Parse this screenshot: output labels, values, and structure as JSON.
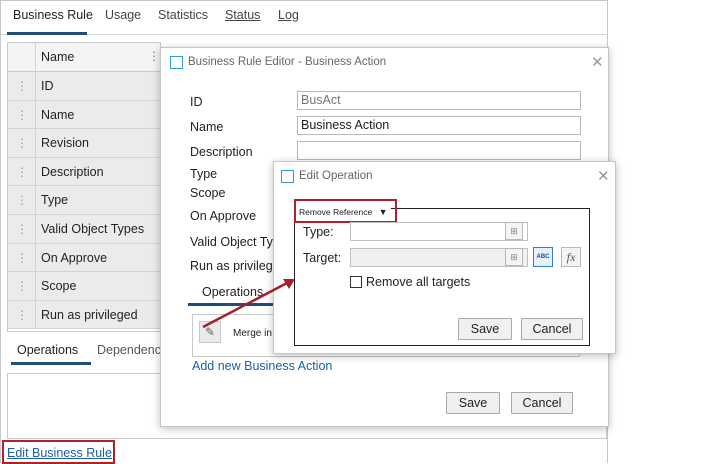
{
  "main": {
    "tabs": [
      {
        "label": "Business Rule"
      },
      {
        "label": "Usage"
      },
      {
        "label": "Statistics"
      },
      {
        "label": "Status"
      },
      {
        "label": "Log"
      }
    ],
    "table_header": "Name",
    "rows": [
      {
        "label": "ID"
      },
      {
        "label": "Name"
      },
      {
        "label": "Revision"
      },
      {
        "label": "Description"
      },
      {
        "label": "Type"
      },
      {
        "label": "Valid Object Types"
      },
      {
        "label": "On Approve"
      },
      {
        "label": "Scope"
      },
      {
        "label": "Run as privileged"
      }
    ],
    "lower_tabs": [
      {
        "label": "Operations"
      },
      {
        "label": "Dependencie"
      }
    ],
    "footer_link": "Edit Business Rule"
  },
  "editor": {
    "title": "Business Rule Editor - Business Action",
    "fields": {
      "id_label": "ID",
      "id_value": "BusAct",
      "name_label": "Name",
      "name_value": "Business Action",
      "description_label": "Description",
      "type_label": "Type",
      "scope_label": "Scope",
      "on_approve_label": "On Approve",
      "valid_types_label": "Valid Object Ty",
      "run_privileged_label": "Run as privilege"
    },
    "operations_tab": "Operations",
    "operation_item": "Merge in",
    "add_link": "Add new Business Action",
    "save_label": "Save",
    "cancel_label": "Cancel"
  },
  "edit_operation": {
    "title": "Edit Operation",
    "dropdown_value": "Remove Reference",
    "type_label": "Type:",
    "target_label": "Target:",
    "abc_button": "ABC",
    "fx_button": "fx",
    "checkbox_label": "Remove all targets",
    "save_label": "Save",
    "cancel_label": "Cancel"
  },
  "colors": {
    "highlight_red": "#b4202a",
    "accent_blue": "#1f4e79",
    "link_blue": "#1a5fa8"
  }
}
